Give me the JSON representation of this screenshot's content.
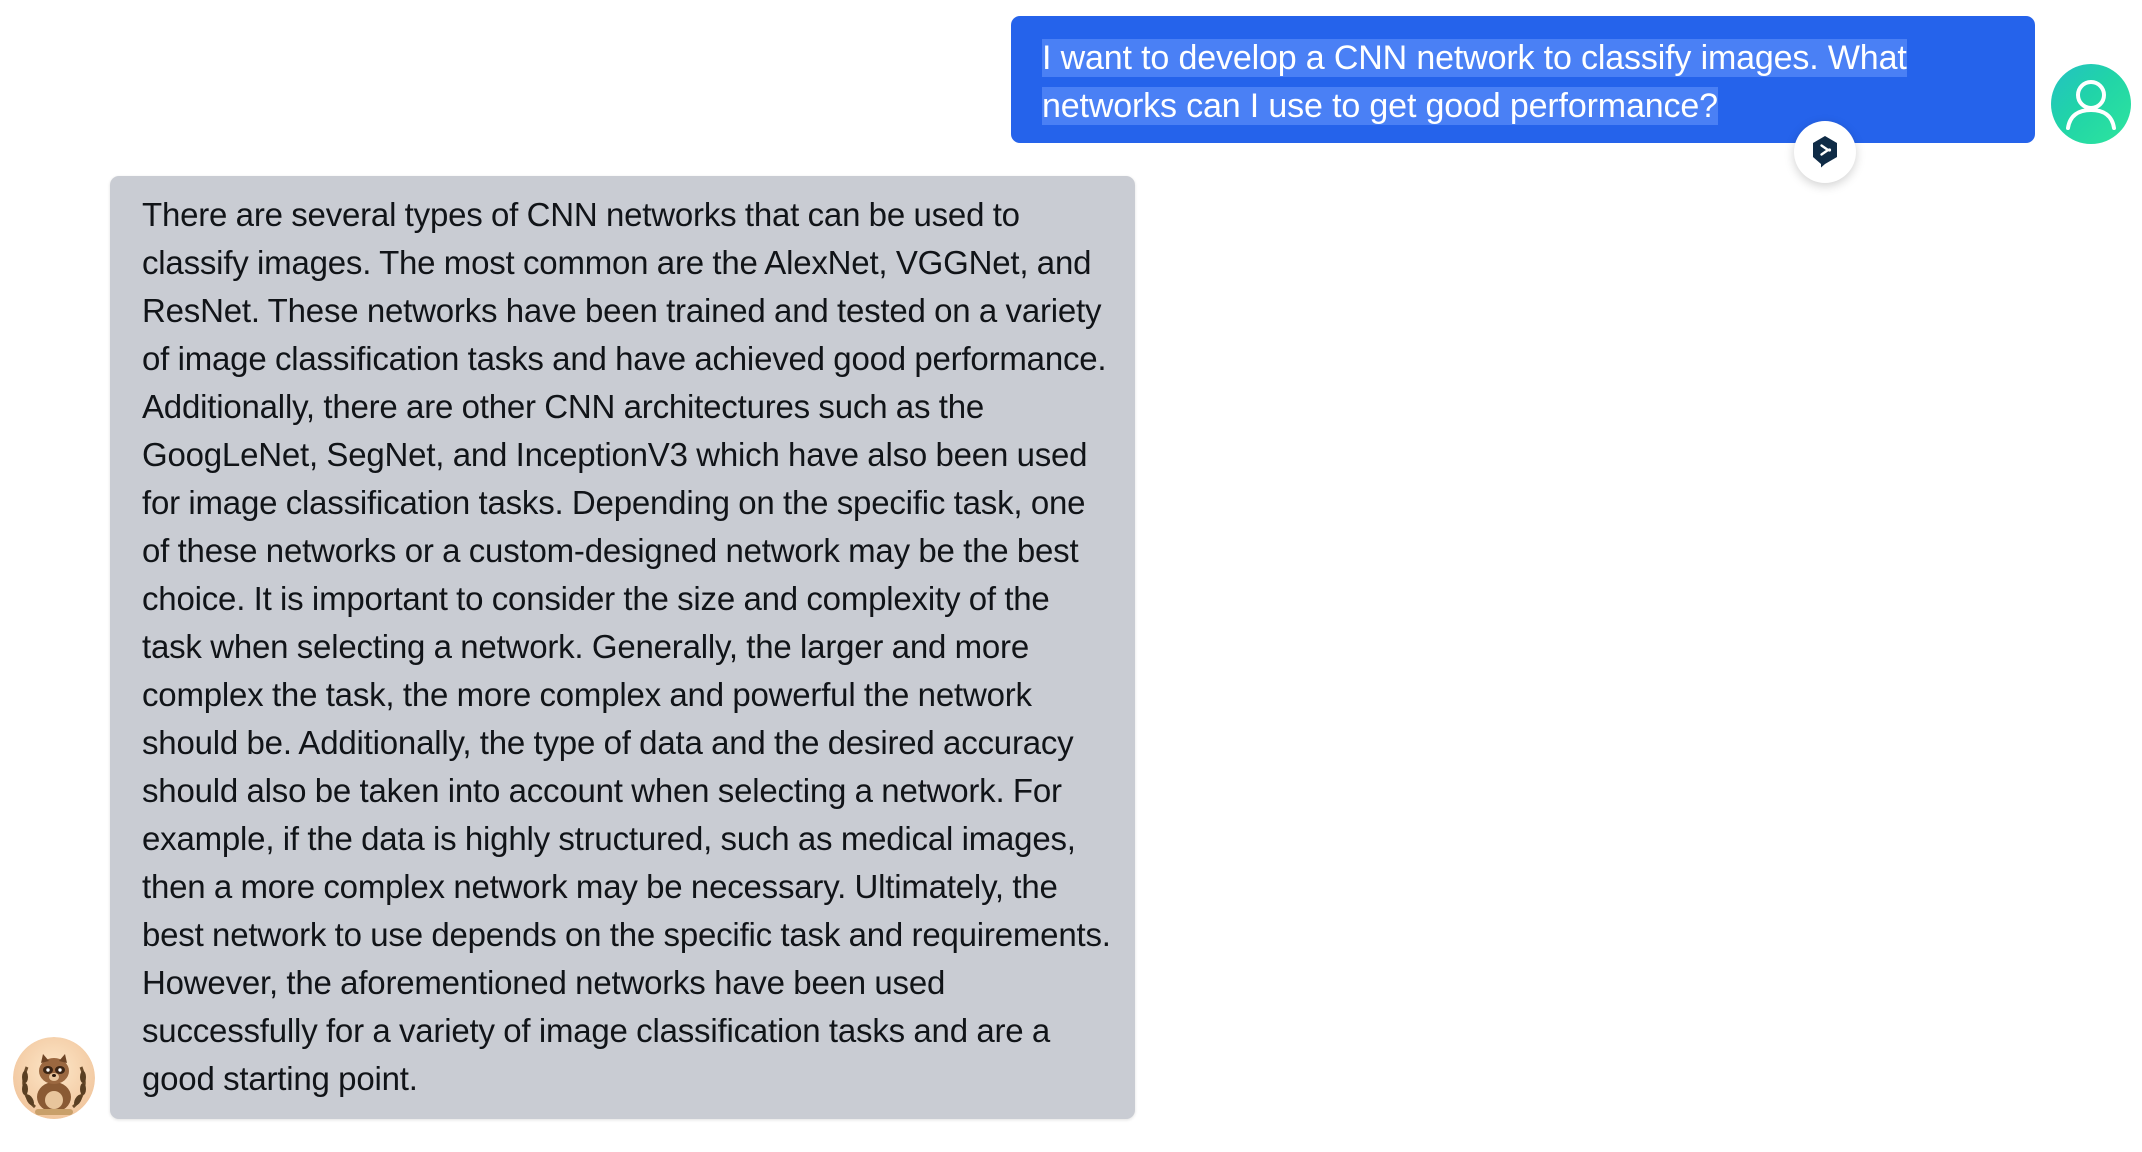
{
  "conversation": {
    "user_message": {
      "text": "I want to develop a CNN network to classify images. What networks can I use to get good performance?",
      "avatar_icon": "user-icon",
      "bubble_color": "#2563eb",
      "selection_color": "#4a80f5"
    },
    "translate_badge": {
      "icon": "deepl-translate-icon"
    },
    "assistant_message": {
      "text": "There are several types of CNN networks that can be used to classify images. The most common are the AlexNet, VGGNet, and ResNet. These networks have been trained and tested on a variety of image classification tasks and have achieved good performance. Additionally, there are other CNN architectures such as the GoogLeNet, SegNet, and InceptionV3 which have also been used for image classification tasks. Depending on the specific task, one of these networks or a custom-designed network may be the best choice. It is important to consider the size and complexity of the task when selecting a network. Generally, the larger and more complex the task, the more complex and powerful the network should be. Additionally, the type of data and the desired accuracy should also be taken into account when selecting a network. For example, if the data is highly structured, such as medical images, then a more complex network may be necessary. Ultimately, the best network to use depends on the specific task and requirements. However, the aforementioned networks have been used successfully for a variety of image classification tasks and are a good starting point.",
      "avatar_icon": "raccoon-avatar-icon",
      "bubble_color": "#c9ccd3"
    }
  }
}
